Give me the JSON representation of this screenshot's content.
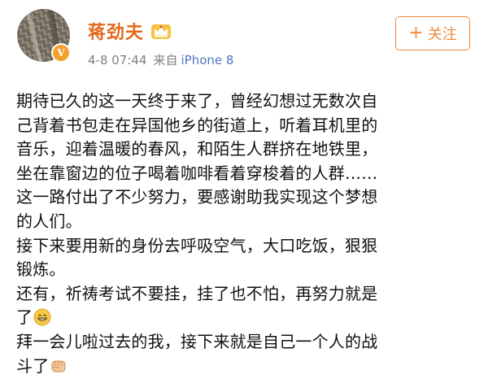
{
  "user": {
    "name": "蒋劲夫",
    "verified_badge": "V",
    "vip_icon": "crown-icon"
  },
  "meta": {
    "time": "4-8 07:44",
    "from_label": "来自",
    "device": "iPhone 8"
  },
  "follow_button": {
    "icon": "plus-icon",
    "plus_glyph": "+",
    "label": "关注"
  },
  "post": {
    "lines": [
      "期待已久的这一天终于来了，曾经幻想过无数次自",
      "己背着书包走在异国他乡的街道上，听着耳机里的",
      "音乐，迎着温暖的春风，和陌生人群挤在地铁里，",
      "坐在靠窗边的位子喝着咖啡看着穿梭着的人群……",
      "这一路付出了不少努力，要感谢助我实现这个梦想",
      "的人们。",
      "接下来要用新的身份去呼吸空气，大口吃饭，狠狠",
      "锻炼。",
      "还有，祈祷考试不要挂，挂了也不怕，再努力就是",
      "了",
      "拜一会儿啦过去的我，接下来就是自己一个人的战",
      "斗了"
    ],
    "emojis": [
      "grinning-emoji",
      "fist-emoji"
    ]
  },
  "colors": {
    "username": "#e06a1b",
    "follow_accent": "#f08a3c",
    "meta_text": "#7f7f7f",
    "device_link": "#4a78c0",
    "badge": "#f2a12d"
  }
}
